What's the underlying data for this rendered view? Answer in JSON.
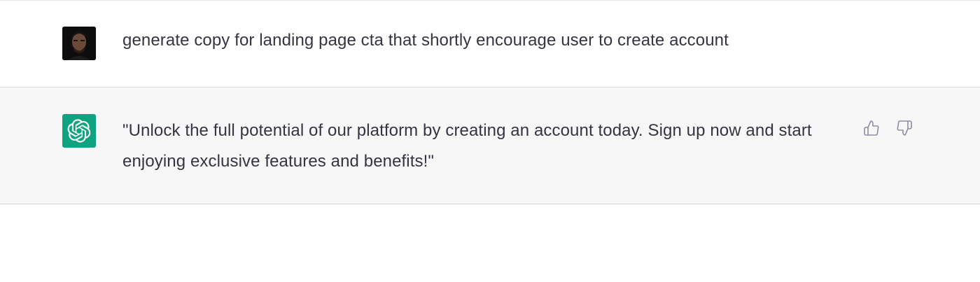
{
  "conversation": {
    "user_message": {
      "text": "generate copy for landing page cta that shortly encourage user to create account"
    },
    "assistant_message": {
      "text": "\"Unlock the full potential of our platform by creating an account today. Sign up now and start enjoying exclusive features and benefits!\""
    }
  },
  "feedback": {
    "thumbs_up_icon": "thumbs-up-icon",
    "thumbs_down_icon": "thumbs-down-icon"
  },
  "colors": {
    "assistant_bg": "#f7f7f8",
    "bot_avatar": "#10a37f",
    "text": "#343541",
    "icon": "#8e8ea0"
  }
}
